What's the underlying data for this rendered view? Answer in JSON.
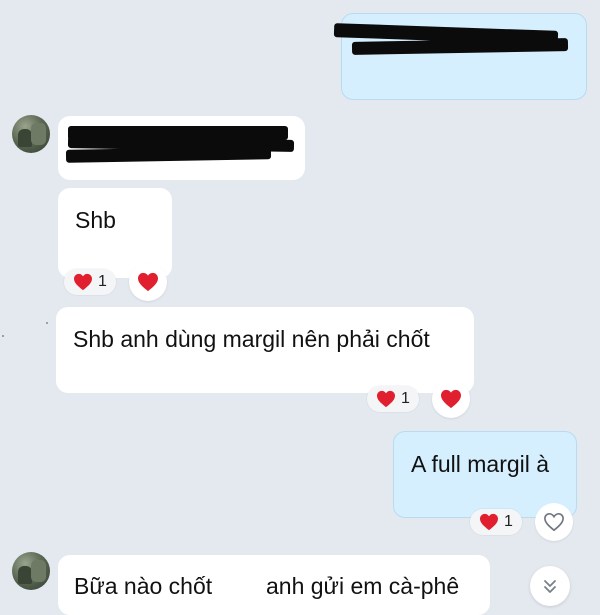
{
  "messages": [
    {
      "id": "m1",
      "from": "me",
      "text_redacted": true
    },
    {
      "id": "m2",
      "from": "other",
      "text_redacted": true
    },
    {
      "id": "m3",
      "from": "other",
      "text": "Shb",
      "reaction_count": "1"
    },
    {
      "id": "m4",
      "from": "other",
      "text": "Shb anh dùng margil nên phải chốt",
      "reaction_count": "1"
    },
    {
      "id": "m5",
      "from": "me",
      "text": "A full margil à",
      "reaction_count": "1"
    },
    {
      "id": "m6",
      "from": "other",
      "text_left": "Bữa nào chốt",
      "text_right": "anh gửi em cà-phê"
    }
  ],
  "icons": {
    "reaction": "heart-icon",
    "react_button_filled": "heart-icon",
    "react_button_empty": "heart-outline-icon",
    "scroll": "chevron-double-down-icon"
  },
  "colors": {
    "background": "#e4e8ef",
    "incoming_bubble": "#ffffff",
    "outgoing_bubble": "#d5efff",
    "heart": "#e0202e"
  }
}
